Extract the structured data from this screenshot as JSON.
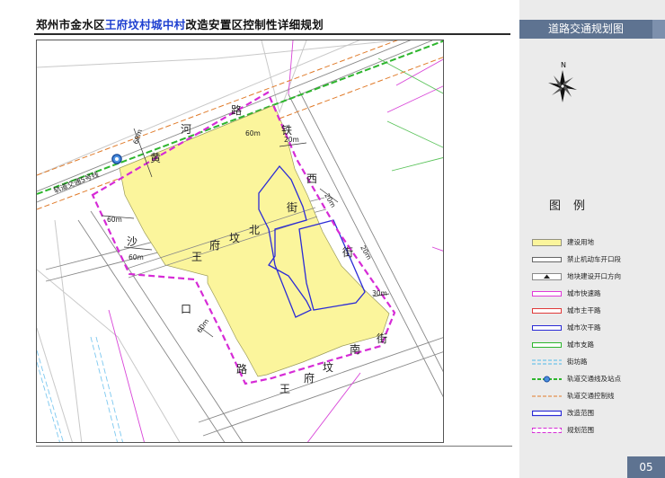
{
  "title": {
    "part1": "郑州市金水区",
    "part2": "王府坟村城中村",
    "part3": "改造安置区控制性详细规划"
  },
  "side_header": "道路交通规划图",
  "north_label": "N",
  "legend_title": "图例",
  "legend": [
    {
      "key": "land",
      "label": "建设用地",
      "color": "#fbf59c"
    },
    {
      "key": "noentry",
      "label": "禁止机动车开口段",
      "color": "#444444"
    },
    {
      "key": "entrance",
      "label": "地块建设开口方向",
      "color": "#222222"
    },
    {
      "key": "expressway",
      "label": "城市快速路",
      "color": "#e03ad8"
    },
    {
      "key": "arterial",
      "label": "城市主干路",
      "color": "#e03a3a"
    },
    {
      "key": "secondary",
      "label": "城市次干路",
      "color": "#2b2bd6"
    },
    {
      "key": "branch",
      "label": "城市支路",
      "color": "#2db52d"
    },
    {
      "key": "lane",
      "label": "街坊路",
      "color": "#4fb8e8"
    },
    {
      "key": "rail",
      "label": "轨道交通线及站点",
      "color": "#2db52d"
    },
    {
      "key": "railcontrol",
      "label": "轨道交通控制线",
      "color": "#e07b2a"
    },
    {
      "key": "renewal",
      "label": "改造范围",
      "color": "#2b2bd6"
    },
    {
      "key": "planning",
      "label": "规划范围",
      "color": "#d62bd6"
    }
  ],
  "map": {
    "roads": {
      "huanghe": [
        "黄",
        "河",
        "路"
      ],
      "tiexi": [
        "铁",
        "西",
        "街"
      ],
      "shakou": [
        "沙",
        "口",
        "路"
      ],
      "wfn": [
        "王",
        "府",
        "坟",
        "北",
        "街"
      ],
      "wfs": [
        "王",
        "府",
        "坟",
        "南",
        "街"
      ]
    },
    "rail_label": "轨道交通5号线",
    "widths": [
      "60m",
      "20m",
      "60m",
      "60m",
      "60m",
      "30m",
      "20m",
      "20m",
      "60m"
    ]
  },
  "page_number": "05"
}
